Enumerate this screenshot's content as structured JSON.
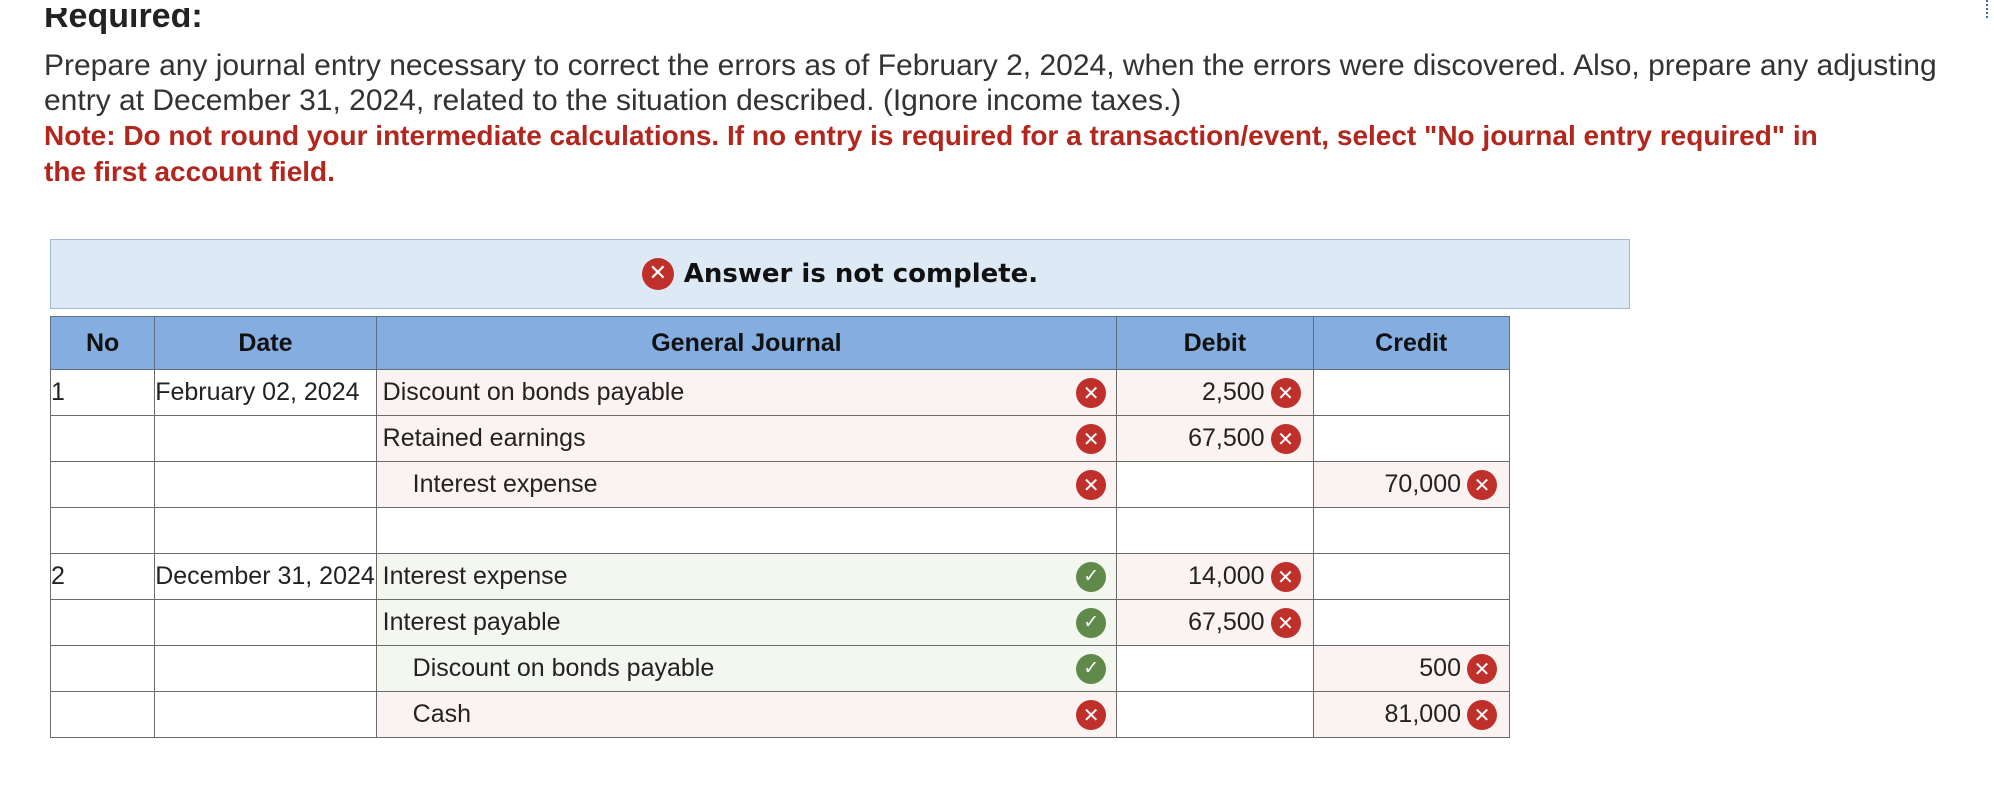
{
  "heading": "Required:",
  "instructions": "Prepare any journal entry necessary to correct the errors as of February 2, 2024, when the errors were discovered. Also, prepare any adjusting entry at December 31, 2024, related to the situation described. (Ignore income taxes.)",
  "note": "Note: Do not round your intermediate calculations. If no entry is required for a transaction/event, select \"No journal entry required\" in the first account field.",
  "banner": {
    "text": "Answer is not complete.",
    "icon": "x-icon"
  },
  "table": {
    "headers": {
      "no": "No",
      "date": "Date",
      "journal": "General Journal",
      "debit": "Debit",
      "credit": "Credit"
    },
    "rows": [
      {
        "no": "1",
        "date": "February 02, 2024",
        "account": "Discount on bonds payable",
        "indent": false,
        "status": "incorrect",
        "debit": "2,500",
        "debit_status": "incorrect",
        "credit": "",
        "credit_status": ""
      },
      {
        "no": "",
        "date": "",
        "account": "Retained earnings",
        "indent": false,
        "status": "incorrect",
        "debit": "67,500",
        "debit_status": "incorrect",
        "credit": "",
        "credit_status": ""
      },
      {
        "no": "",
        "date": "",
        "account": "Interest expense",
        "indent": true,
        "status": "incorrect",
        "debit": "",
        "debit_status": "",
        "credit": "70,000",
        "credit_status": "incorrect"
      },
      {
        "no": "",
        "date": "",
        "account": "",
        "indent": false,
        "status": "",
        "debit": "",
        "debit_status": "",
        "credit": "",
        "credit_status": ""
      },
      {
        "no": "2",
        "date": "December 31, 2024",
        "account": "Interest expense",
        "indent": false,
        "status": "correct",
        "debit": "14,000",
        "debit_status": "incorrect",
        "credit": "",
        "credit_status": ""
      },
      {
        "no": "",
        "date": "",
        "account": "Interest payable",
        "indent": false,
        "status": "correct",
        "debit": "67,500",
        "debit_status": "incorrect",
        "credit": "",
        "credit_status": ""
      },
      {
        "no": "",
        "date": "",
        "account": "Discount on bonds payable",
        "indent": true,
        "status": "correct",
        "debit": "",
        "debit_status": "",
        "credit": "500",
        "credit_status": "incorrect"
      },
      {
        "no": "",
        "date": "",
        "account": "Cash",
        "indent": true,
        "status": "incorrect",
        "debit": "",
        "debit_status": "",
        "credit": "81,000",
        "credit_status": "incorrect"
      }
    ]
  },
  "colors": {
    "error": "#c0302b",
    "correct": "#5f8a4a",
    "header_bg": "#84aee0",
    "banner_bg": "#dde9f5",
    "note_text": "#b3261e"
  }
}
